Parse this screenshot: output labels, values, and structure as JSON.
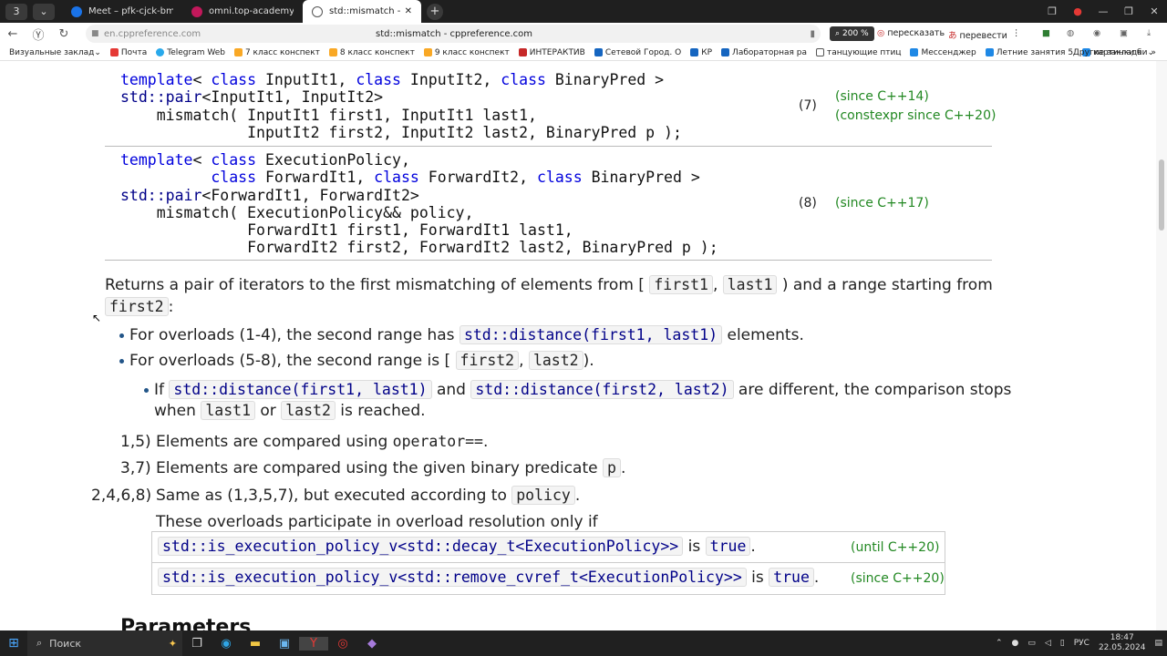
{
  "browser": {
    "tabs": [
      {
        "label": "Meet – pfk-cjck-bma",
        "color": "#1a73e8"
      },
      {
        "label": "omni.top-academy.ru/#/p",
        "color": "#c2185b"
      },
      {
        "label": "std::mismatch - cppreference",
        "color": "#cccccc",
        "active": true
      }
    ],
    "tab_counter": "3",
    "address_host": "en.cppreference.com",
    "page_title": "std::mismatch - cppreference.com",
    "zoom": "200 %",
    "retell_label": "пересказать",
    "translate_label": "перевести",
    "bookmarks_label": "Визуальные заклад",
    "bookmarks": [
      {
        "label": "Почта",
        "color": "#e53935"
      },
      {
        "label": "Telegram Web",
        "color": "#29a9eb"
      },
      {
        "label": "7 класс конспект",
        "color": "#f9a825"
      },
      {
        "label": "8 класс конспект",
        "color": "#f9a825"
      },
      {
        "label": "9 класс конспект",
        "color": "#f9a825"
      },
      {
        "label": "ИНТЕРАКТИВ",
        "color": "#c62828"
      },
      {
        "label": "Сетевой Город. О",
        "color": "#1565c0"
      },
      {
        "label": "КР",
        "color": "#1565c0"
      },
      {
        "label": "Лабораторная ра",
        "color": "#1565c0"
      },
      {
        "label": "танцующие птиц",
        "color": "#555555"
      },
      {
        "label": "Мессенджер",
        "color": "#1e88e5"
      },
      {
        "label": "Летние занятия 5",
        "color": "#1e88e5"
      },
      {
        "label": "картинки б",
        "color": "#1e88e5"
      }
    ],
    "other_bookmarks": "Другие закладки"
  },
  "page": {
    "overload7": {
      "num": "(7)",
      "since1": "(since C++14)",
      "since2": "(constexpr since C++20)"
    },
    "overload8": {
      "num": "(8)",
      "since1": "(since C++17)"
    },
    "desc": {
      "p1_a": "Returns a pair of iterators to the first mismatching of elements from [",
      "first1": "first1",
      "comma": ",",
      "last1": "last1",
      "p1_b": ") and a range starting from",
      "first2": "first2",
      "colon": ":",
      "b1_a": "For overloads (1-4), the second range has",
      "dist1": "std::distance(first1, last1)",
      "b1_b": "elements.",
      "b2_a": "For overloads (5-8), the second range is [",
      "last2": "last2",
      "b2_b": ").",
      "b3_a": "If",
      "dist2": "std::distance(first2, last2)",
      "and": "and",
      "b3_b": "are different, the comparison stops",
      "b3_c": "when",
      "or": "or",
      "b3_d": "is reached."
    },
    "items": [
      {
        "num": "1,5)",
        "text": "Elements are compared using",
        "code": "operator==",
        "end": "."
      },
      {
        "num": "3,7)",
        "text": "Elements are compared using the given binary predicate",
        "code": "p",
        "end": "."
      },
      {
        "num": "2,4,6,8)",
        "text": "Same as (1,3,5,7), but executed according to",
        "code": "policy",
        "end": "."
      }
    ],
    "overload_note": "These overloads participate in overload resolution only if",
    "cond_rows": [
      {
        "expr": "std::is_execution_policy_v<std::decay_t<ExecutionPolicy>>",
        "is": "is",
        "val": "true",
        "dot": ".",
        "since": "(until C++20)"
      },
      {
        "expr": "std::is_execution_policy_v<std::remove_cvref_t<ExecutionPolicy>>",
        "is": "is",
        "val": "true",
        "dot": ".",
        "since": "(since C++20)"
      }
    ],
    "heading": "Parameters"
  },
  "taskbar": {
    "search": "Поиск",
    "lang": "РУС",
    "time": "18:47",
    "date": "22.05.2024"
  }
}
